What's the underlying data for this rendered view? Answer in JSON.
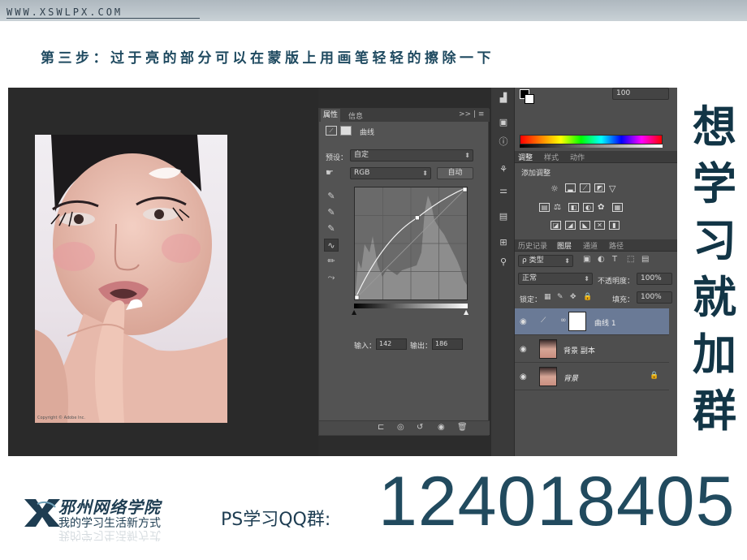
{
  "header": {
    "site_url": "WWW.XSWLPX.COM",
    "step_title": "第三步：过于亮的部分可以在蒙版上用画笔轻轻的擦除一下"
  },
  "photo": {
    "caption": "Copyright © Adobe Inc."
  },
  "properties_panel": {
    "tabs": [
      "属性",
      "信息"
    ],
    "panel_controls": ">> | ≡",
    "adjustment_name": "曲线",
    "preset_label": "预设：",
    "preset_value": "自定",
    "channel_value": "RGB",
    "auto_button": "自动",
    "input_label": "输入：",
    "input_value": "142",
    "output_label": "输出：",
    "output_value": "186",
    "curve_point": {
      "input": 142,
      "output": 186
    }
  },
  "color_panel": {
    "value": "100"
  },
  "adjustments_panel": {
    "tabs": [
      "调整",
      "样式",
      "动作"
    ],
    "add_label": "添加调整"
  },
  "layers_panel": {
    "tabs": [
      "历史记录",
      "图层",
      "通道",
      "路径"
    ],
    "filter_type": "ρ 类型",
    "blend_mode": "正常",
    "opacity_label": "不透明度：",
    "opacity_value": "100%",
    "lock_label": "锁定：",
    "fill_label": "填充：",
    "fill_value": "100%",
    "layers": [
      {
        "name": "曲线 1",
        "selected": true
      },
      {
        "name": "背景 副本",
        "selected": false
      },
      {
        "name": "背景",
        "selected": false
      }
    ]
  },
  "side_text": [
    "想",
    "学",
    "习",
    "就",
    "加",
    "群"
  ],
  "footer": {
    "logo_name": "邪州网络学院",
    "slogan": "我的学习生活新方式",
    "qq_label": "PS学习QQ群:",
    "qq_number": "124018405"
  },
  "colors": {
    "brand_dark": "#1e3d52",
    "ps_panel": "#535353",
    "selected_layer": "#6a7a96"
  }
}
